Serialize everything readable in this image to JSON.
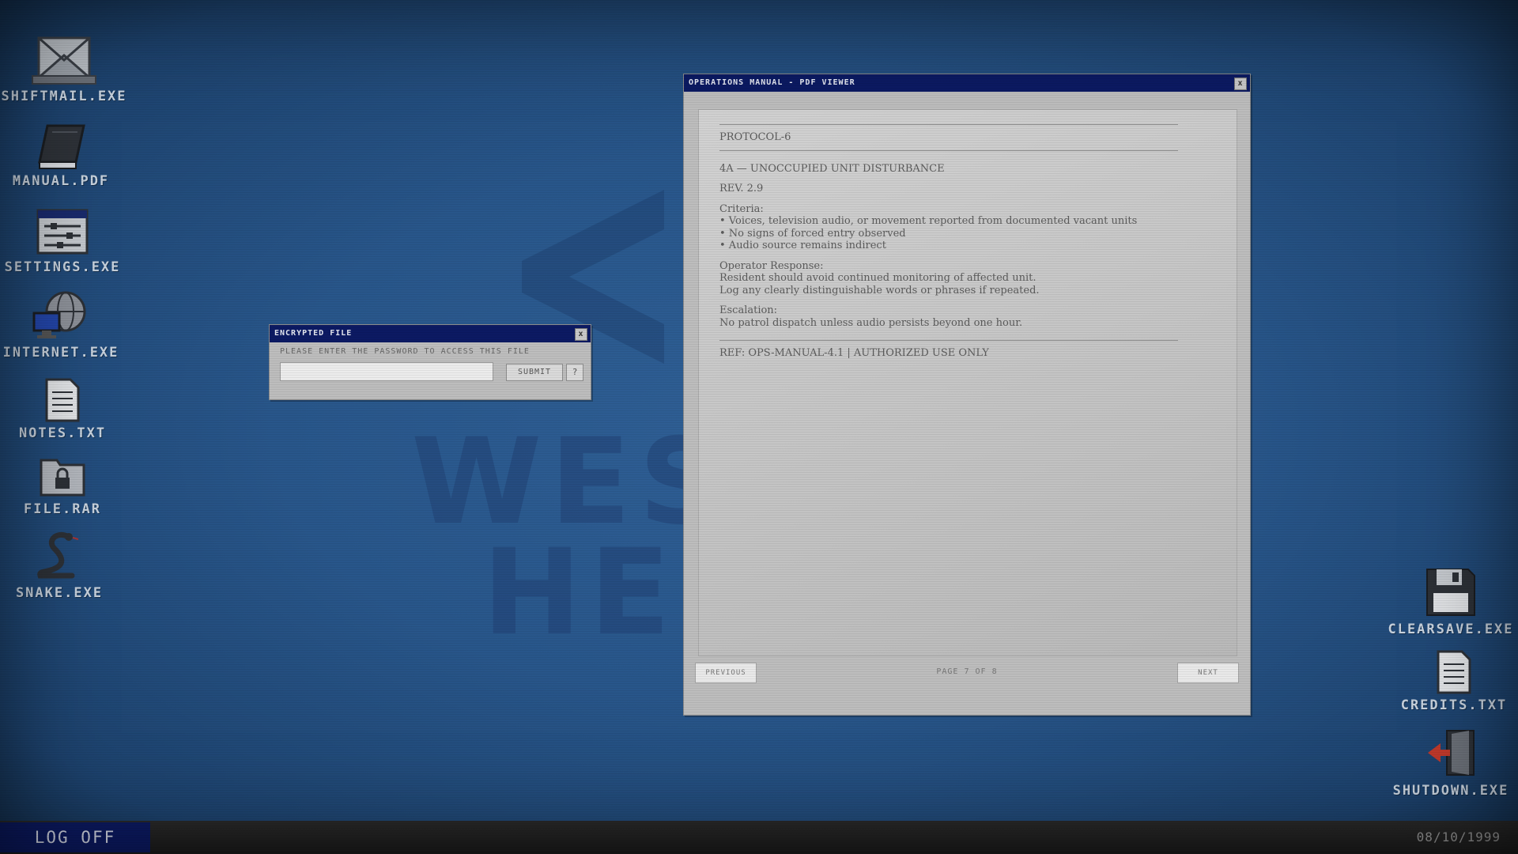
{
  "desktop": {
    "watermark": {
      "line1": "WES",
      "line2": "HEI"
    },
    "left_icons": [
      {
        "label": "SHIFTMAIL.EXE",
        "icon": "mail-icon"
      },
      {
        "label": "MANUAL.PDF",
        "icon": "book-icon"
      },
      {
        "label": "SETTINGS.EXE",
        "icon": "settings-panel-icon"
      },
      {
        "label": "INTERNET.EXE",
        "icon": "globe-computer-icon"
      },
      {
        "label": "NOTES.TXT",
        "icon": "text-document-icon"
      },
      {
        "label": "FILE.RAR",
        "icon": "locked-folder-icon"
      },
      {
        "label": "SNAKE.EXE",
        "icon": "snake-icon"
      }
    ],
    "right_icons": [
      {
        "label": "CLEARSAVE.EXE",
        "icon": "floppy-disk-icon"
      },
      {
        "label": "CREDITS.TXT",
        "icon": "text-document-icon"
      },
      {
        "label": "SHUTDOWN.EXE",
        "icon": "exit-door-icon"
      }
    ]
  },
  "encrypted_dialog": {
    "title": "ENCRYPTED FILE",
    "close": "x",
    "prompt": "PLEASE ENTER THE PASSWORD TO ACCESS THIS FILE",
    "input_value": "",
    "submit_label": "SUBMIT",
    "help_label": "?"
  },
  "pdf_viewer": {
    "title": "OPERATIONS MANUAL - PDF VIEWER",
    "close": "x",
    "protocol": "PROTOCOL-6",
    "section": "4A — UNOCCUPIED UNIT DISTURBANCE",
    "rev": "REV. 2.9",
    "criteria_heading": "Criteria:",
    "criteria": [
      "• Voices, television audio, or movement reported from documented vacant units",
      "• No signs of forced entry observed",
      "• Audio source remains indirect"
    ],
    "response_heading": "Operator Response:",
    "response": [
      "Resident should avoid continued monitoring of affected unit.",
      "Log any clearly distinguishable words or phrases if repeated."
    ],
    "escalation_heading": "Escalation:",
    "escalation": "No patrol dispatch unless audio persists beyond one hour.",
    "reference": "REF: OPS-MANUAL-4.1 | AUTHORIZED USE ONLY",
    "prev_label": "PREVIOUS",
    "next_label": "NEXT",
    "page_indicator": "PAGE 7 OF 8"
  },
  "taskbar": {
    "logoff_label": "LOG OFF",
    "date": "08/10/1999"
  },
  "colors": {
    "desktop": "#2b5a8e",
    "titlebar": "#0c1a63",
    "window": "#bdbdbd"
  }
}
